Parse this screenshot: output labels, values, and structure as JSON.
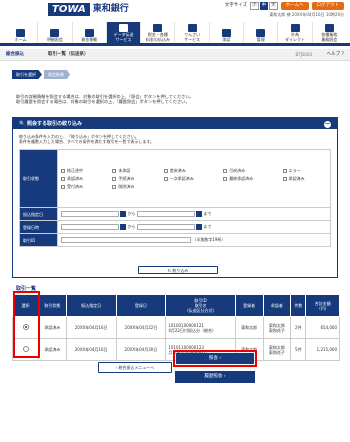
{
  "header": {
    "logo_mark": "TOWA",
    "bank_name": "東和銀行",
    "font_size_label": "文字サイズ",
    "font_sizes": [
      "小",
      "中",
      "大"
    ],
    "home_label": "ホームへ",
    "logout_label": "ログアウト",
    "user_line": "東和太郎 様 20XX年04月16日 10時20分"
  },
  "nav": [
    {
      "label": "ホーム",
      "icon": "home-icon"
    },
    {
      "label": "明細照会",
      "icon": "list-icon"
    },
    {
      "label": "資金移動",
      "icon": "transfer-icon"
    },
    {
      "label": "データ伝送\nサービス",
      "icon": "data-icon",
      "active": true
    },
    {
      "label": "税金・各種\n料金の払込み",
      "icon": "tax-icon"
    },
    {
      "label": "でんさい\nサービス",
      "icon": "densai-icon"
    },
    {
      "label": "承認",
      "icon": "approve-icon"
    },
    {
      "label": "管理",
      "icon": "manage-icon"
    },
    {
      "label": "外為\nダイレクト",
      "icon": "forex-icon"
    },
    {
      "label": "各種業務\n業務照会",
      "icon": "business-icon"
    }
  ],
  "titlebar": {
    "crumb": "総合振込",
    "title": "取引一覧（伝送系）",
    "code": "BTJS020",
    "help": "ヘルプ"
  },
  "steps": [
    "取引を選択",
    "照会結果"
  ],
  "intro": "取引の詳細情報を照会する場合は、対象の取引を選択の上、「照会」ボタンを押してください。\n取引履歴を照会する場合は、対象の取引を選択の上、「履歴照会」ボタンを押してください。",
  "filter": {
    "title": "照会する取引の絞り込み",
    "toggle": "－",
    "desc": "絞り込み条件を入力の上、「絞り込み」ボタンを押してください。\n条件を複数入力した場合、すべての条件を満たす取引を一覧で表示します。",
    "status_label": "取引状態",
    "statuses": [
      "修正途中",
      "未承認",
      "差戻済み",
      "引戻済み",
      "エラー",
      "承認済み",
      "手続済み",
      "一次承認済み",
      "最終承認済み",
      "承認済み",
      "受付済み",
      "削除済み"
    ],
    "date_label": "振込指定日",
    "from": "から",
    "to": "まで",
    "date2_label": "登録日時",
    "id_label": "取引ID",
    "id_hint": "（半角数字19桁）",
    "filter_btn": "絞り込み"
  },
  "list": {
    "title": "取引一覧",
    "headers": [
      "選択",
      "取引状態",
      "振込指定日",
      "登録日",
      "取引ID\n取引名\n（伝送区分方式）",
      "登録者",
      "承認者",
      "件数",
      "合計金額\n（円）"
    ],
    "rows": [
      {
        "selected": true,
        "status": "承認済み",
        "date": "20XX年04月16日",
        "reg": "20XX年04月22日",
        "id": "10100100000121\n4月22日付振込分（総合）",
        "user": "東和太郎",
        "appr": "東和太郎\n東和花子",
        "count": "2件",
        "amt": "654,000"
      },
      {
        "selected": false,
        "status": "承認済み",
        "date": "20XX年04月16日",
        "reg": "20XX年04月30日",
        "id": "10101100000123\n月末振込分(総合振込)",
        "user": "東和太郎",
        "appr": "東和太郎\n東和花子",
        "count": "5件",
        "amt": "1,215,000"
      }
    ]
  },
  "back_btn": "総合振込メニューへ",
  "confirm_btn": "照会",
  "history_btn": "履歴照会"
}
